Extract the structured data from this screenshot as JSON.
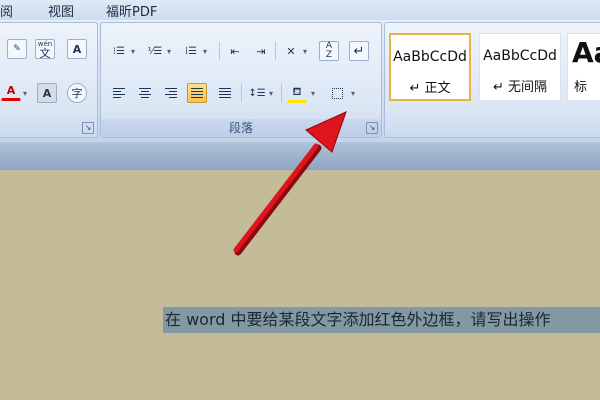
{
  "menu": {
    "review_partial": "阅",
    "view": "视图",
    "foxit_pdf": "福昕PDF"
  },
  "font_group": {
    "btn_phonetic": "文",
    "btn_border_char": "A",
    "btn_text_highlight": "A",
    "btn_enclose": "字",
    "btn_font_color": "A",
    "wen_top": "wén"
  },
  "paragraph_group": {
    "label": "段落",
    "sort_label": "A",
    "sort_label2": "Z"
  },
  "styles": {
    "items": [
      {
        "sample": "AaBbCcDd",
        "name": "↵ 正文",
        "selected": true
      },
      {
        "sample": "AaBbCcDd",
        "name": "↵ 无间隔",
        "selected": false
      },
      {
        "sample": "Aa",
        "name": "标",
        "selected": false
      }
    ]
  },
  "document": {
    "selected_text": "在 word 中要给某段文字添加红色外边框，请写出操作"
  },
  "colors": {
    "arrow": "#e0141c",
    "selection": "#8299a3",
    "page": "#c4bb98"
  }
}
